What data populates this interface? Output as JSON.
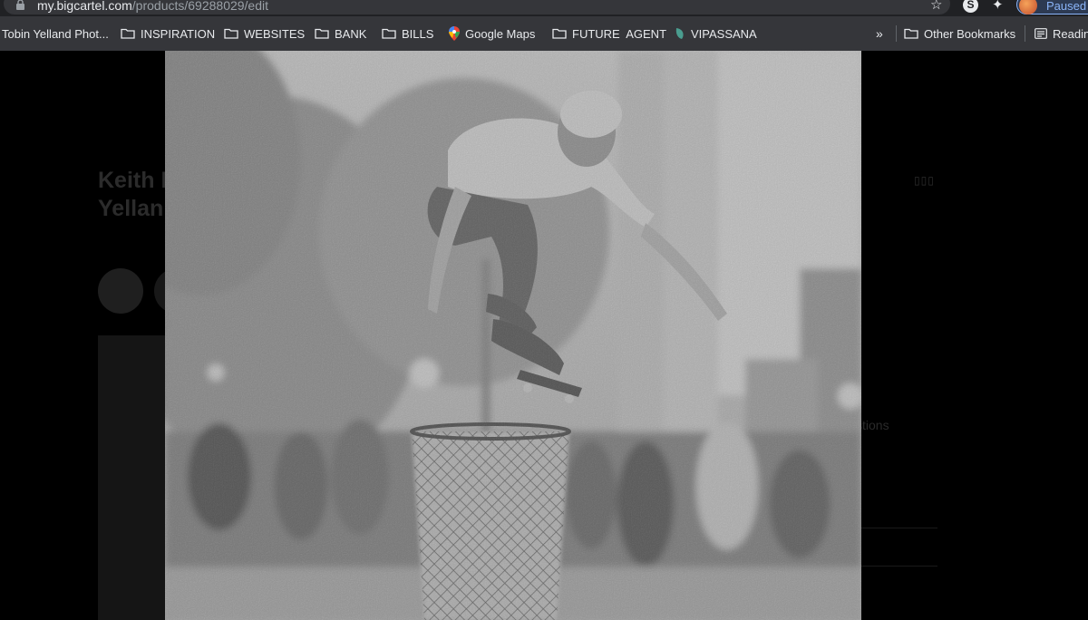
{
  "browser": {
    "url_host": "my.bigcartel.com",
    "url_path": "/products/69288029/edit",
    "profile_status": "Paused",
    "extension_letter": "S"
  },
  "bookmarks": [
    {
      "label": "Tobin Yelland Phot...",
      "icon": "page-icon"
    },
    {
      "label": "INSPIRATION",
      "icon": "folder-icon"
    },
    {
      "label": "WEBSITES",
      "icon": "folder-icon"
    },
    {
      "label": "BANK",
      "icon": "folder-icon"
    },
    {
      "label": "BILLS",
      "icon": "folder-icon"
    },
    {
      "label": "Google Maps",
      "icon": "maps-pin-icon"
    },
    {
      "label": "FUTURE  AGENT",
      "icon": "folder-icon"
    },
    {
      "label": "VIPASSANA",
      "icon": "leaf-icon"
    }
  ],
  "bookmarks_overflow": "»",
  "other_bookmarks": "Other Bookmarks",
  "reading_list": "Readin",
  "background_page": {
    "title_line1": "Keith H",
    "title_line2": "Yellan",
    "dots": "▯▯▯",
    "questions_fragment": "stions"
  },
  "colors": {
    "toolbar": "#35363a",
    "omnibox": "#202124",
    "accent": "#8ab4f8"
  }
}
